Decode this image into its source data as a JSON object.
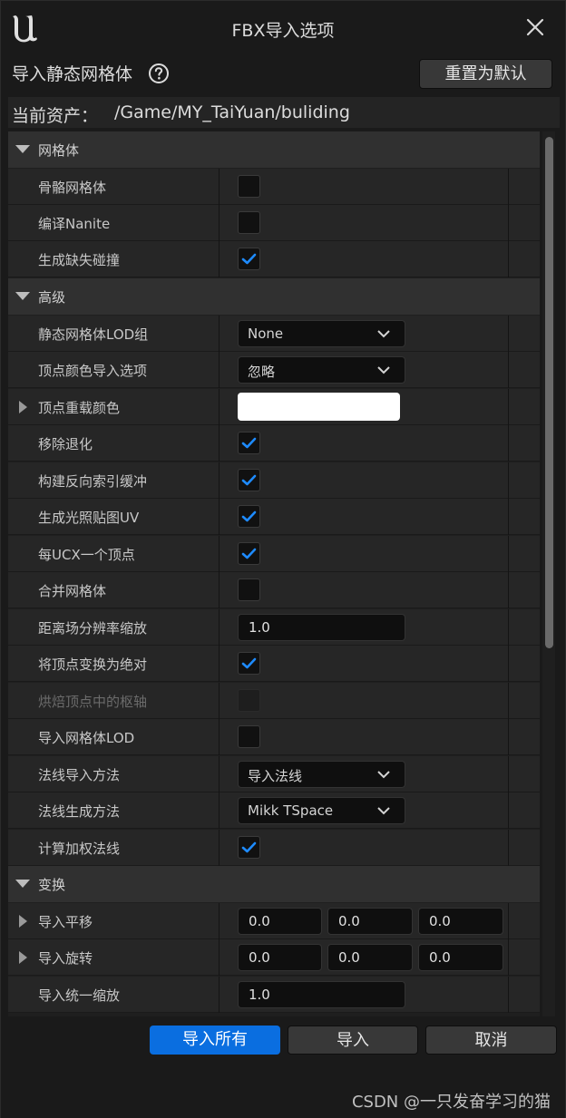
{
  "window": {
    "title": "FBX导入选项"
  },
  "header": {
    "title": "导入静态网格体",
    "reset_label": "重置为默认"
  },
  "asset": {
    "label": "当前资产：",
    "path": "/Game/MY_TaiYuan/buliding"
  },
  "sections": {
    "mesh": {
      "label": "网格体",
      "skeletal": {
        "label": "骨骼网格体",
        "checked": false
      },
      "nanite": {
        "label": "编译Nanite",
        "checked": false
      },
      "collision": {
        "label": "生成缺失碰撞",
        "checked": true
      }
    },
    "advanced": {
      "label": "高级",
      "lod_group": {
        "label": "静态网格体LOD组",
        "value": "None"
      },
      "vertex_color_import": {
        "label": "顶点颜色导入选项",
        "value": "忽略"
      },
      "vertex_override_color": {
        "label": "顶点重载颜色",
        "color": "#ffffff"
      },
      "remove_degenerates": {
        "label": "移除退化",
        "checked": true
      },
      "build_reversed_index": {
        "label": "构建反向索引缓冲",
        "checked": true
      },
      "generate_lightmap_uv": {
        "label": "生成光照贴图UV",
        "checked": true
      },
      "one_convex_per_ucx": {
        "label": "每UCX一个顶点",
        "checked": true
      },
      "combine_meshes": {
        "label": "合并网格体",
        "checked": false
      },
      "distance_field_scale": {
        "label": "距离场分辨率缩放",
        "value": "1.0"
      },
      "transform_vertex_absolute": {
        "label": "将顶点变换为绝对",
        "checked": true
      },
      "bake_pivot": {
        "label": "烘焙顶点中的枢轴",
        "checked": false
      },
      "import_mesh_lods": {
        "label": "导入网格体LOD",
        "checked": false
      },
      "normal_import_method": {
        "label": "法线导入方法",
        "value": "导入法线"
      },
      "normal_generation_method": {
        "label": "法线生成方法",
        "value": "Mikk TSpace"
      },
      "compute_weighted_normals": {
        "label": "计算加权法线",
        "checked": true
      }
    },
    "transform": {
      "label": "变换",
      "translation": {
        "label": "导入平移",
        "x": "0.0",
        "y": "0.0",
        "z": "0.0"
      },
      "rotation": {
        "label": "导入旋转",
        "x": "0.0",
        "y": "0.0",
        "z": "0.0"
      },
      "uniform_scale": {
        "label": "导入统一缩放",
        "value": "1.0"
      }
    }
  },
  "footer": {
    "import_all_label": "导入所有",
    "import_label": "导入",
    "cancel_label": "取消"
  },
  "watermark": "CSDN @一只发奋学习的猫",
  "colors": {
    "accent": "#0a6ee0",
    "check": "#1e8bff",
    "background": "#1a1a1a"
  }
}
